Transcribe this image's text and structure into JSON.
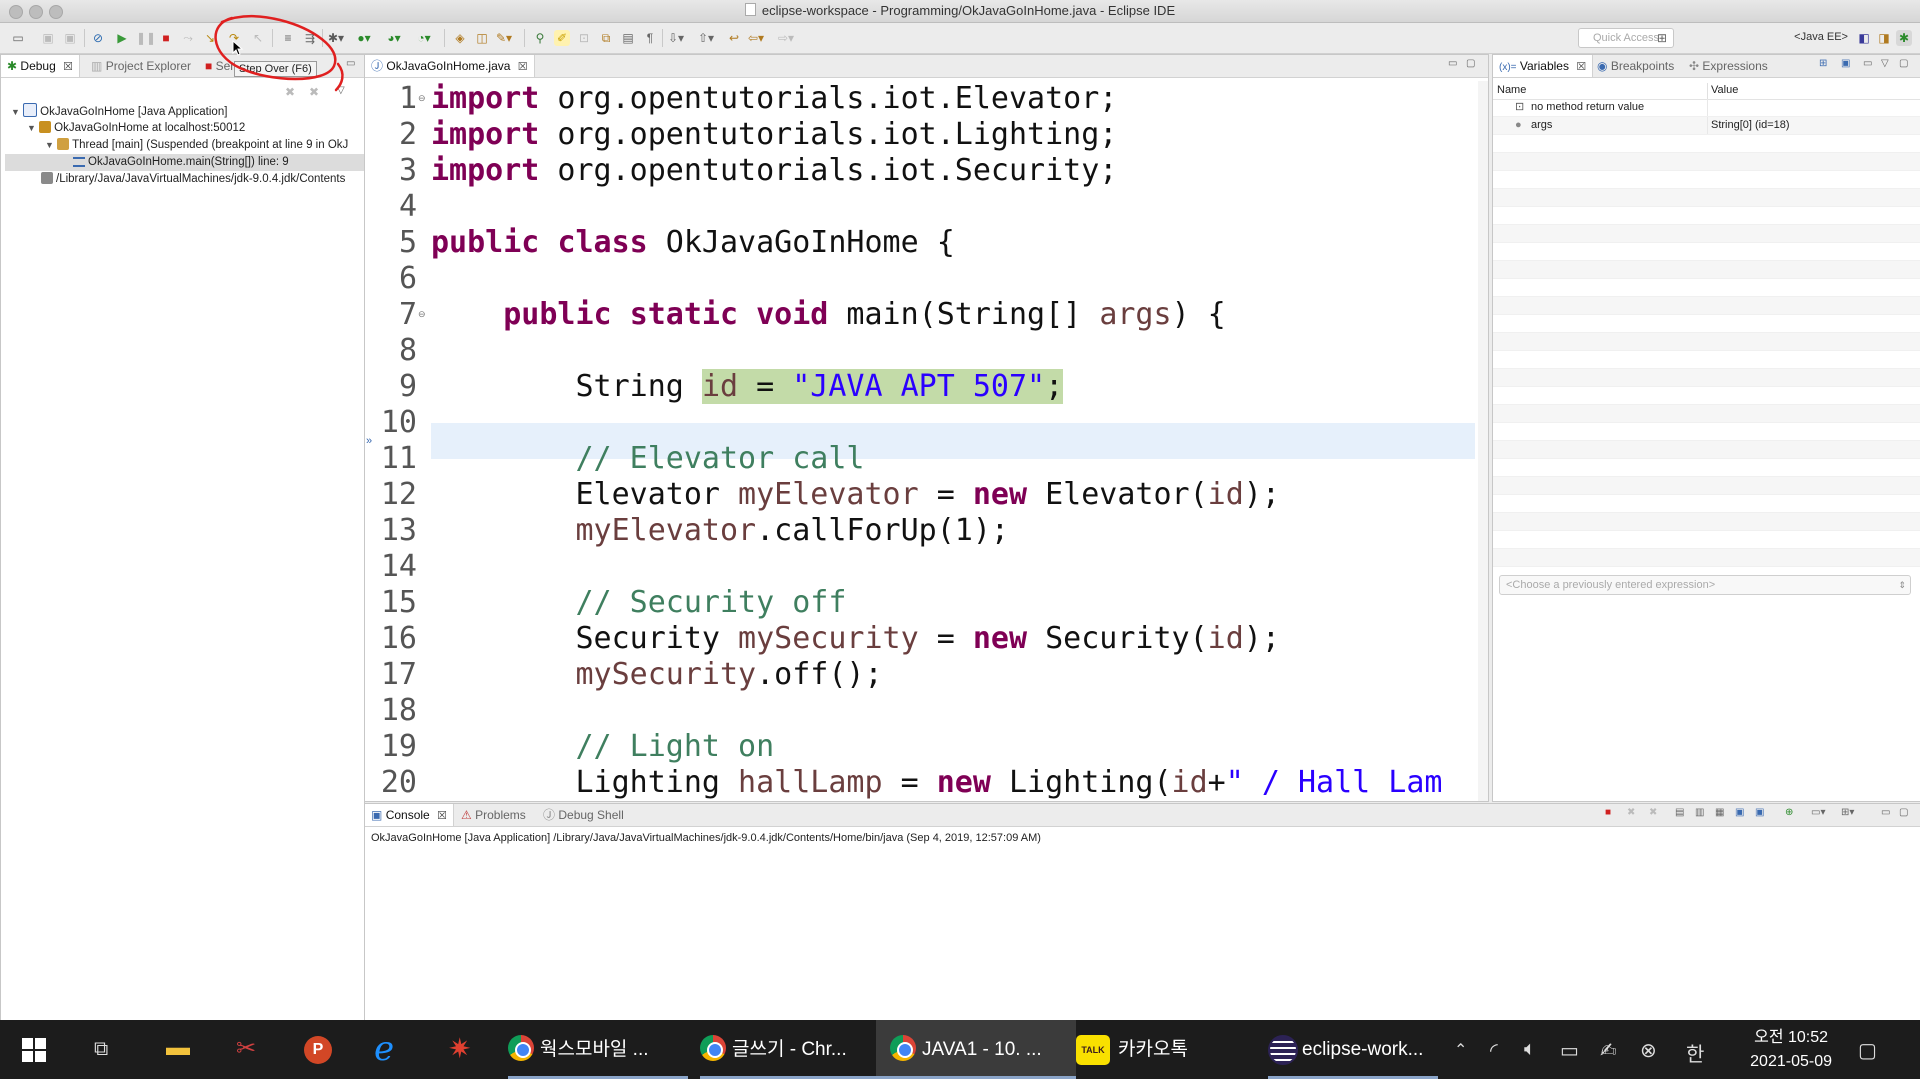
{
  "window": {
    "title": "eclipse-workspace - Programming/OkJavaGoInHome.java - Eclipse IDE"
  },
  "toolbar": {
    "tooltip": "Step Over (F6)",
    "quick_access_placeholder": "Quick Access",
    "perspective": "<Java EE>"
  },
  "debug_view": {
    "tabs": [
      {
        "label": "Debug"
      },
      {
        "label": "Project Explorer"
      },
      {
        "label": "Ser"
      }
    ],
    "tree": [
      {
        "label": "OkJavaGoInHome [Java Application]"
      },
      {
        "label": "OkJavaGoInHome at localhost:50012"
      },
      {
        "label": "Thread [main] (Suspended (breakpoint at line 9 in OkJ"
      },
      {
        "label": "OkJavaGoInHome.main(String[]) line: 9"
      },
      {
        "label": "/Library/Java/JavaVirtualMachines/jdk-9.0.4.jdk/Contents"
      }
    ]
  },
  "editor": {
    "tab_label": "OkJavaGoInHome.java",
    "current_line": 9,
    "lines": [
      {
        "n": "1"
      },
      {
        "n": "2"
      },
      {
        "n": "3"
      },
      {
        "n": "4"
      },
      {
        "n": "5"
      },
      {
        "n": "6"
      },
      {
        "n": "7"
      },
      {
        "n": "8"
      },
      {
        "n": "9"
      },
      {
        "n": "10"
      },
      {
        "n": "11"
      },
      {
        "n": "12"
      },
      {
        "n": "13"
      },
      {
        "n": "14"
      },
      {
        "n": "15"
      },
      {
        "n": "16"
      },
      {
        "n": "17"
      },
      {
        "n": "18"
      },
      {
        "n": "19"
      },
      {
        "n": "20"
      }
    ],
    "code": {
      "l1": [
        "import",
        " org.opentutorials.iot.Elevator;"
      ],
      "l2": [
        "import",
        " org.opentutorials.iot.Lighting;"
      ],
      "l3": [
        "import",
        " org.opentutorials.iot.Security;"
      ],
      "l5": [
        "public",
        " ",
        "class",
        " OkJavaGoInHome {"
      ],
      "l7": [
        "    ",
        "public",
        " ",
        "static",
        " ",
        "void",
        " main(String[] ",
        "args",
        ") {"
      ],
      "l9": [
        "        String ",
        "id",
        " = ",
        "\"JAVA APT 507\"",
        ";"
      ],
      "l11": [
        "        ",
        "// Elevator call"
      ],
      "l12": [
        "        Elevator ",
        "myElevator",
        " = ",
        "new",
        " Elevator(",
        "id",
        ");"
      ],
      "l13": [
        "        ",
        "myElevator",
        ".callForUp(1);"
      ],
      "l15": [
        "        ",
        "// Security off"
      ],
      "l16": [
        "        Security ",
        "mySecurity",
        " = ",
        "new",
        " Security(",
        "id",
        ");"
      ],
      "l17": [
        "        ",
        "mySecurity",
        ".off();"
      ],
      "l19": [
        "        ",
        "// Light on"
      ],
      "l20": [
        "        Lighting ",
        "hallLamp",
        " = ",
        "new",
        " Lighting(",
        "id",
        "+",
        "\" / Hall Lam"
      ]
    }
  },
  "variables_view": {
    "tabs": [
      {
        "label": "Variables"
      },
      {
        "label": "Breakpoints"
      },
      {
        "label": "Expressions"
      }
    ],
    "columns": {
      "name": "Name",
      "value": "Value"
    },
    "rows": [
      {
        "name": "no method return value",
        "value": ""
      },
      {
        "name": "args",
        "value": "String[0]  (id=18)"
      }
    ],
    "expression_placeholder": "<Choose a previously entered expression>"
  },
  "console_view": {
    "tabs": [
      {
        "label": "Console"
      },
      {
        "label": "Problems"
      },
      {
        "label": "Debug Shell"
      }
    ],
    "header": "OkJavaGoInHome [Java Application] /Library/Java/JavaVirtualMachines/jdk-9.0.4.jdk/Contents/Home/bin/java (Sep 4, 2019, 12:57:09 AM)"
  },
  "taskbar": {
    "items": [
      {
        "label": "웍스모바일 ..."
      },
      {
        "label": "글쓰기 - Chr..."
      },
      {
        "label": "JAVA1 - 10. ..."
      },
      {
        "label": "카카오톡"
      },
      {
        "label": "eclipse-work..."
      }
    ],
    "ime": "한",
    "time": "오전 10:52",
    "date": "2021-05-09"
  },
  "colors": {
    "keyword": "#7f0055",
    "string": "#2a00ff",
    "comment": "#3f7f5f",
    "variable": "#6a3e3e",
    "current_line_highlight": "#c3dba8",
    "annotation_red": "#e02020"
  }
}
